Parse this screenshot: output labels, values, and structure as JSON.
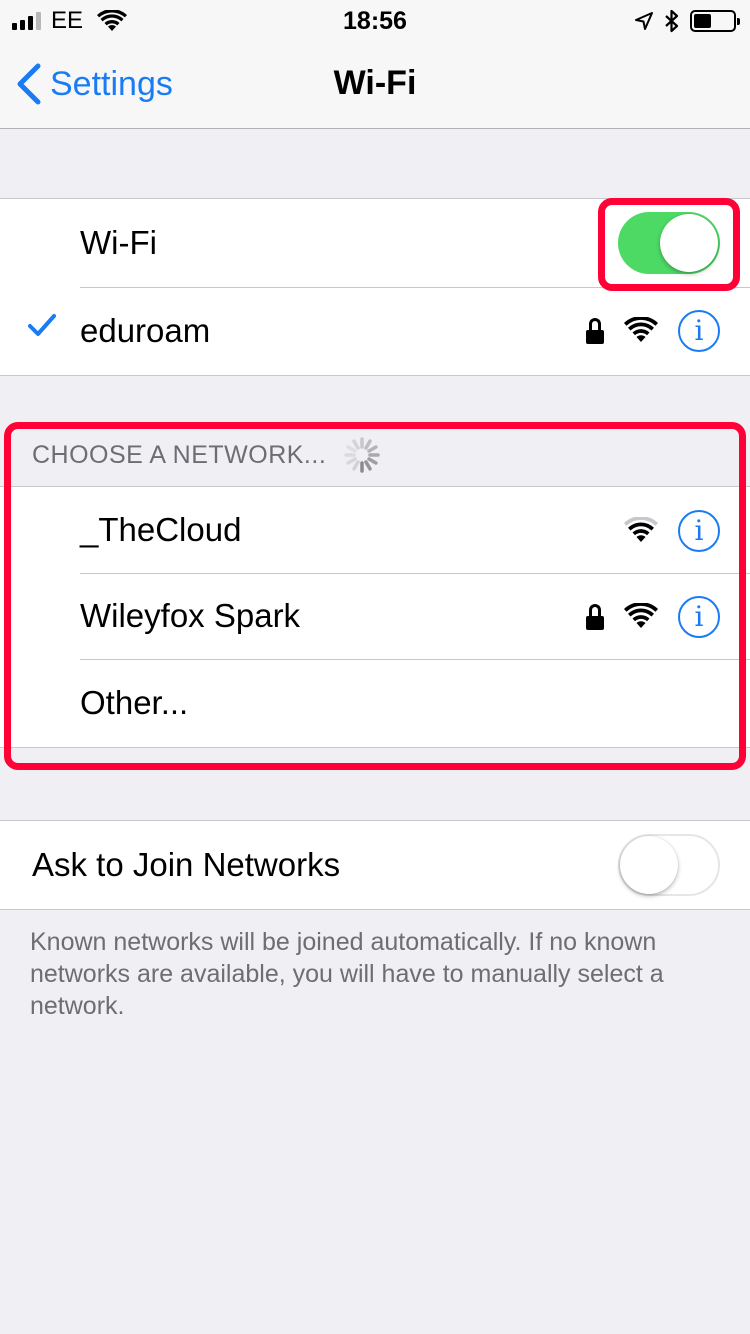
{
  "status_bar": {
    "carrier": "EE",
    "time": "18:56",
    "battery_level": 0.45
  },
  "nav": {
    "back_label": "Settings",
    "title": "Wi-Fi"
  },
  "wifi": {
    "label": "Wi-Fi",
    "enabled": true
  },
  "connected": {
    "name": "eduroam",
    "secured": true,
    "signal_icon": "wifi-full-icon",
    "info": "i"
  },
  "choose_network": {
    "header": "CHOOSE A NETWORK...",
    "networks": [
      {
        "name": "_TheCloud",
        "secured": false,
        "signal_icon": "wifi-medium-icon",
        "info": "i"
      },
      {
        "name": "Wileyfox Spark",
        "secured": true,
        "signal_icon": "wifi-full-icon",
        "info": "i"
      }
    ],
    "other_label": "Other..."
  },
  "ask_to_join": {
    "label": "Ask to Join Networks",
    "enabled": false,
    "footer": "Known networks will be joined automatically. If no known networks are available, you will have to manually select a network."
  },
  "colors": {
    "accent": "#1a7cf5",
    "toggle_on": "#4cd964",
    "highlight": "#ff0037",
    "background": "#efeff4"
  }
}
